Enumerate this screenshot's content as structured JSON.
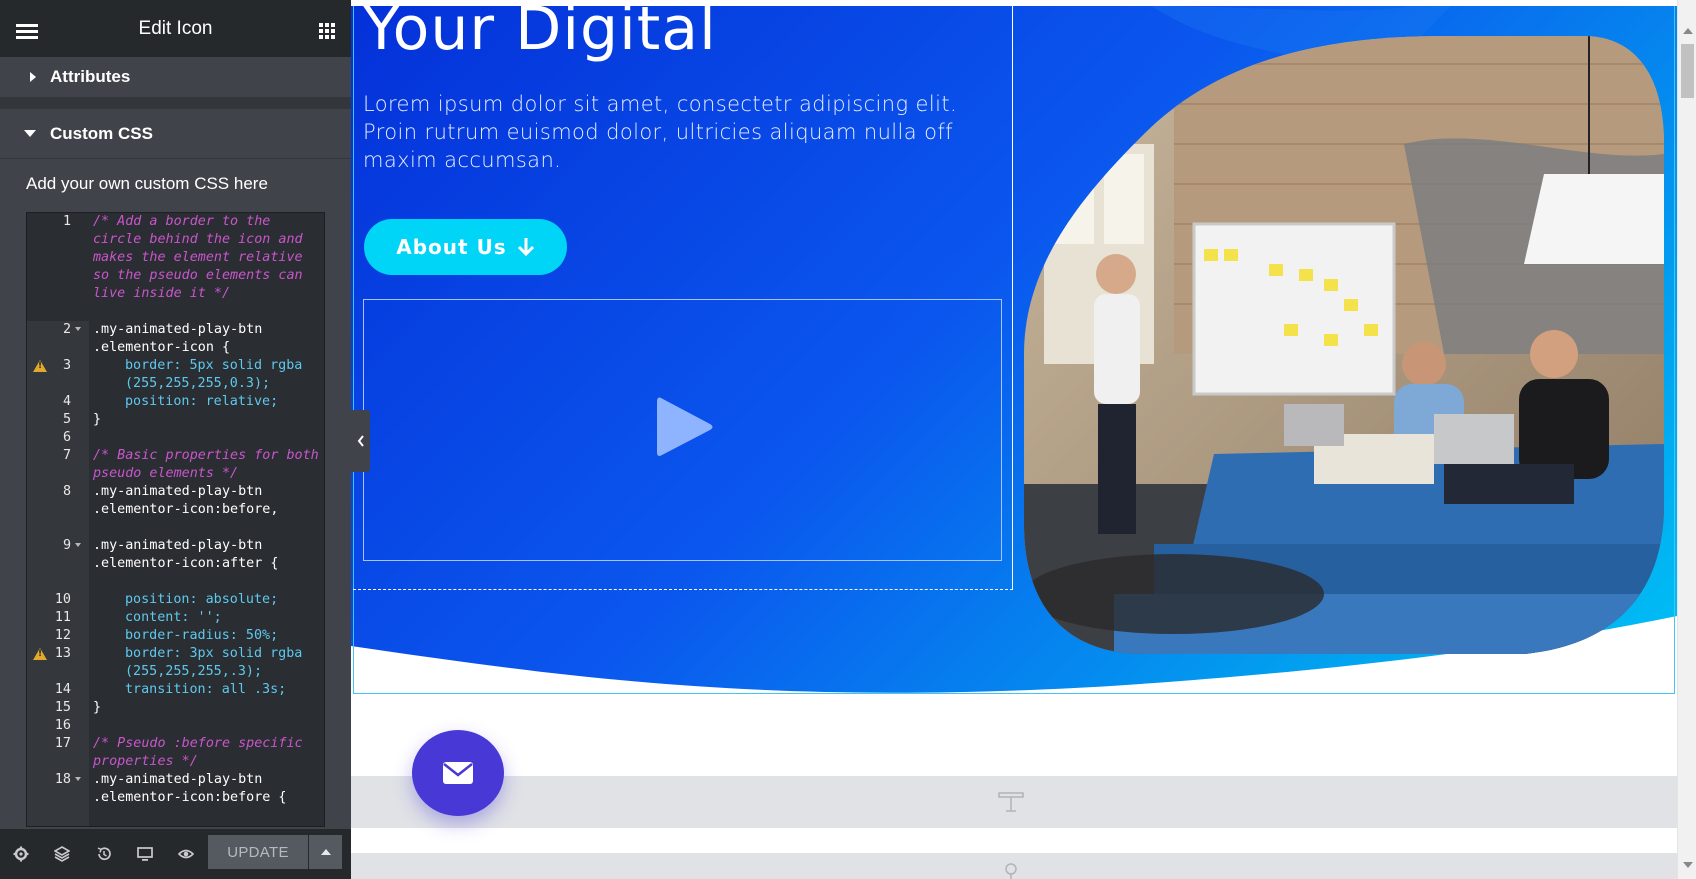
{
  "panel": {
    "title": "Edit Icon",
    "sections": {
      "attributes": "Attributes",
      "custom_css": "Custom CSS"
    },
    "custom_css_help": "Add your own custom CSS here",
    "update_label": "UPDATE",
    "footer_icons": [
      "settings-icon",
      "layers-icon",
      "history-icon",
      "responsive-icon",
      "preview-icon"
    ]
  },
  "code_lines": [
    {
      "n": "1",
      "text": "/* Add a border to the circle behind the icon and makes the element relative so the pseudo elements can live inside it */"
    },
    {
      "n": "2",
      "text": ".my-animated-play-btn .elementor-icon {"
    },
    {
      "n": "3",
      "text": "border: 5px solid rgba (255,255,255,0.3);"
    },
    {
      "n": "4",
      "text": "position: relative;"
    },
    {
      "n": "5",
      "text": "}"
    },
    {
      "n": "6",
      "text": ""
    },
    {
      "n": "7",
      "text": "/* Basic properties for both pseudo elements */"
    },
    {
      "n": "8",
      "text": ".my-animated-play-btn .elementor-icon:before,"
    },
    {
      "n": "9",
      "text": ".my-animated-play-btn .elementor-icon:after {"
    },
    {
      "n": "10",
      "text": "position: absolute;"
    },
    {
      "n": "11",
      "text": "content: '';"
    },
    {
      "n": "12",
      "text": "border-radius: 50%;"
    },
    {
      "n": "13",
      "text": "border: 3px solid rgba (255,255,255,.3);"
    },
    {
      "n": "14",
      "text": "transition: all .3s;"
    },
    {
      "n": "15",
      "text": "}"
    },
    {
      "n": "16",
      "text": ""
    },
    {
      "n": "17",
      "text": "/* Pseudo :before specific properties */"
    },
    {
      "n": "18",
      "text": ".my-animated-play-btn .elementor-icon:before {"
    }
  ],
  "hero": {
    "heading": "Your Digital",
    "text": "Lorem ipsum dolor sit amet, consectetr adipiscing elit. Proin rutrum euismod dolor, ultricies aliquam nulla off maxim accumsan.",
    "about_button": "About Us"
  },
  "colors": {
    "panel_bg": "#404349",
    "panel_header_bg": "#26292c",
    "hero_gradient_start": "#0431d9",
    "hero_gradient_end": "#00c2f5",
    "accent_button": "#00d4f7",
    "mail_fab": "#4838d6"
  }
}
